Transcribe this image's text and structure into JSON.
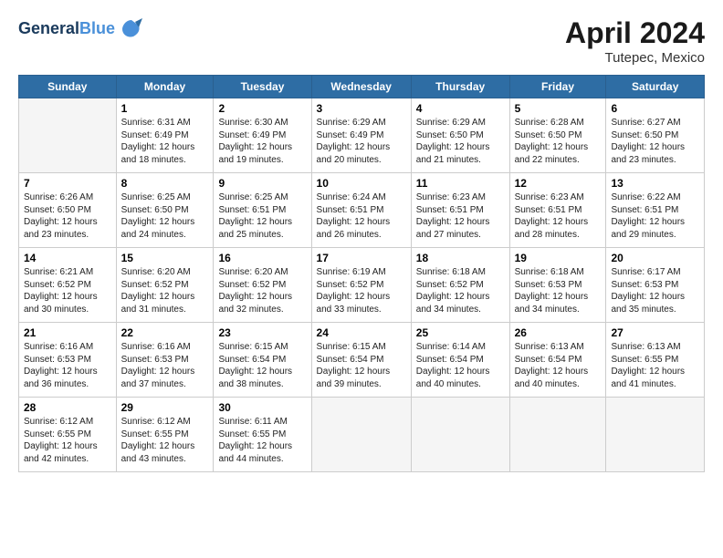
{
  "header": {
    "logo_line1": "General",
    "logo_line2": "Blue",
    "main_title": "April 2024",
    "subtitle": "Tutepec, Mexico"
  },
  "days_of_week": [
    "Sunday",
    "Monday",
    "Tuesday",
    "Wednesday",
    "Thursday",
    "Friday",
    "Saturday"
  ],
  "weeks": [
    [
      {
        "num": "",
        "info": ""
      },
      {
        "num": "1",
        "info": "Sunrise: 6:31 AM\nSunset: 6:49 PM\nDaylight: 12 hours\nand 18 minutes."
      },
      {
        "num": "2",
        "info": "Sunrise: 6:30 AM\nSunset: 6:49 PM\nDaylight: 12 hours\nand 19 minutes."
      },
      {
        "num": "3",
        "info": "Sunrise: 6:29 AM\nSunset: 6:49 PM\nDaylight: 12 hours\nand 20 minutes."
      },
      {
        "num": "4",
        "info": "Sunrise: 6:29 AM\nSunset: 6:50 PM\nDaylight: 12 hours\nand 21 minutes."
      },
      {
        "num": "5",
        "info": "Sunrise: 6:28 AM\nSunset: 6:50 PM\nDaylight: 12 hours\nand 22 minutes."
      },
      {
        "num": "6",
        "info": "Sunrise: 6:27 AM\nSunset: 6:50 PM\nDaylight: 12 hours\nand 23 minutes."
      }
    ],
    [
      {
        "num": "7",
        "info": "Sunrise: 6:26 AM\nSunset: 6:50 PM\nDaylight: 12 hours\nand 23 minutes."
      },
      {
        "num": "8",
        "info": "Sunrise: 6:25 AM\nSunset: 6:50 PM\nDaylight: 12 hours\nand 24 minutes."
      },
      {
        "num": "9",
        "info": "Sunrise: 6:25 AM\nSunset: 6:51 PM\nDaylight: 12 hours\nand 25 minutes."
      },
      {
        "num": "10",
        "info": "Sunrise: 6:24 AM\nSunset: 6:51 PM\nDaylight: 12 hours\nand 26 minutes."
      },
      {
        "num": "11",
        "info": "Sunrise: 6:23 AM\nSunset: 6:51 PM\nDaylight: 12 hours\nand 27 minutes."
      },
      {
        "num": "12",
        "info": "Sunrise: 6:23 AM\nSunset: 6:51 PM\nDaylight: 12 hours\nand 28 minutes."
      },
      {
        "num": "13",
        "info": "Sunrise: 6:22 AM\nSunset: 6:51 PM\nDaylight: 12 hours\nand 29 minutes."
      }
    ],
    [
      {
        "num": "14",
        "info": "Sunrise: 6:21 AM\nSunset: 6:52 PM\nDaylight: 12 hours\nand 30 minutes."
      },
      {
        "num": "15",
        "info": "Sunrise: 6:20 AM\nSunset: 6:52 PM\nDaylight: 12 hours\nand 31 minutes."
      },
      {
        "num": "16",
        "info": "Sunrise: 6:20 AM\nSunset: 6:52 PM\nDaylight: 12 hours\nand 32 minutes."
      },
      {
        "num": "17",
        "info": "Sunrise: 6:19 AM\nSunset: 6:52 PM\nDaylight: 12 hours\nand 33 minutes."
      },
      {
        "num": "18",
        "info": "Sunrise: 6:18 AM\nSunset: 6:52 PM\nDaylight: 12 hours\nand 34 minutes."
      },
      {
        "num": "19",
        "info": "Sunrise: 6:18 AM\nSunset: 6:53 PM\nDaylight: 12 hours\nand 34 minutes."
      },
      {
        "num": "20",
        "info": "Sunrise: 6:17 AM\nSunset: 6:53 PM\nDaylight: 12 hours\nand 35 minutes."
      }
    ],
    [
      {
        "num": "21",
        "info": "Sunrise: 6:16 AM\nSunset: 6:53 PM\nDaylight: 12 hours\nand 36 minutes."
      },
      {
        "num": "22",
        "info": "Sunrise: 6:16 AM\nSunset: 6:53 PM\nDaylight: 12 hours\nand 37 minutes."
      },
      {
        "num": "23",
        "info": "Sunrise: 6:15 AM\nSunset: 6:54 PM\nDaylight: 12 hours\nand 38 minutes."
      },
      {
        "num": "24",
        "info": "Sunrise: 6:15 AM\nSunset: 6:54 PM\nDaylight: 12 hours\nand 39 minutes."
      },
      {
        "num": "25",
        "info": "Sunrise: 6:14 AM\nSunset: 6:54 PM\nDaylight: 12 hours\nand 40 minutes."
      },
      {
        "num": "26",
        "info": "Sunrise: 6:13 AM\nSunset: 6:54 PM\nDaylight: 12 hours\nand 40 minutes."
      },
      {
        "num": "27",
        "info": "Sunrise: 6:13 AM\nSunset: 6:55 PM\nDaylight: 12 hours\nand 41 minutes."
      }
    ],
    [
      {
        "num": "28",
        "info": "Sunrise: 6:12 AM\nSunset: 6:55 PM\nDaylight: 12 hours\nand 42 minutes."
      },
      {
        "num": "29",
        "info": "Sunrise: 6:12 AM\nSunset: 6:55 PM\nDaylight: 12 hours\nand 43 minutes."
      },
      {
        "num": "30",
        "info": "Sunrise: 6:11 AM\nSunset: 6:55 PM\nDaylight: 12 hours\nand 44 minutes."
      },
      {
        "num": "",
        "info": ""
      },
      {
        "num": "",
        "info": ""
      },
      {
        "num": "",
        "info": ""
      },
      {
        "num": "",
        "info": ""
      }
    ]
  ]
}
